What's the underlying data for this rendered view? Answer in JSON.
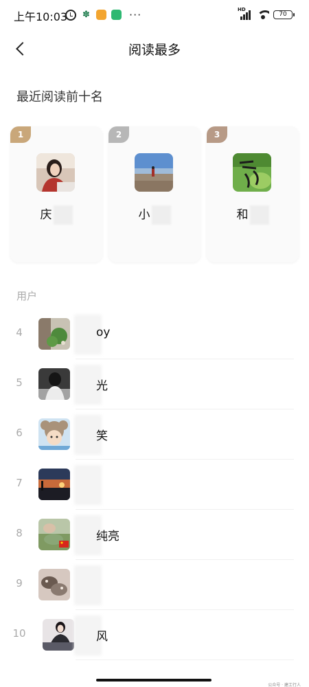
{
  "status_bar": {
    "time": "上午10:03",
    "more": "···",
    "hd": "HD",
    "battery": "70"
  },
  "header": {
    "title": "阅读最多"
  },
  "top_section": {
    "title": "最近阅读前十名",
    "cards": [
      {
        "rank": "1",
        "name": "庆",
        "badge_color": "#c9a77a"
      },
      {
        "rank": "2",
        "name": "小",
        "badge_color": "#b7b7b7"
      },
      {
        "rank": "3",
        "name": "和",
        "badge_color": "#b79a86"
      }
    ]
  },
  "users_section": {
    "label": "用户",
    "items": [
      {
        "rank": "4",
        "name": "oy"
      },
      {
        "rank": "5",
        "name": "光"
      },
      {
        "rank": "6",
        "name": "笑"
      },
      {
        "rank": "7",
        "name": ""
      },
      {
        "rank": "8",
        "name": "纯亮"
      },
      {
        "rank": "9",
        "name": ""
      },
      {
        "rank": "10",
        "name": "风"
      }
    ]
  },
  "watermark": "公众号 · 建工行人"
}
